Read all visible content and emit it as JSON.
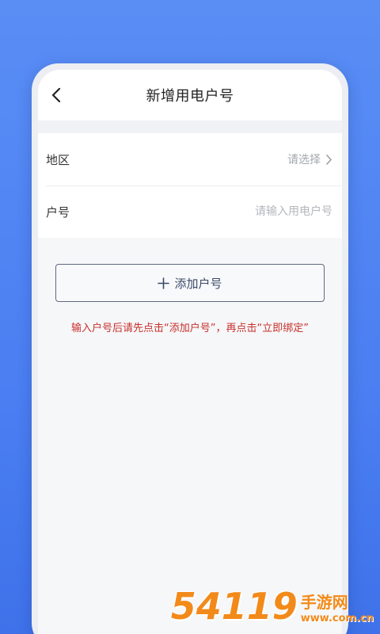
{
  "navbar": {
    "back_icon": "chevron-left-icon",
    "title": "新增用电户号"
  },
  "form": {
    "region": {
      "label": "地区",
      "value": "请选择",
      "icon": "chevron-right-icon"
    },
    "account": {
      "label": "户号",
      "value": "",
      "placeholder": "请输入用电户号"
    }
  },
  "add_button": {
    "icon": "plus-icon",
    "label": "添加户号"
  },
  "hint": "输入户号后请先点击“添加户号”，再点击“立即绑定”",
  "watermark": {
    "number": "54119",
    "text": "手游网",
    "domain": "www.com.cn"
  },
  "colors": {
    "background": "#4b7ff2",
    "hint": "#c8302b",
    "button_border": "#5e6a80",
    "watermark": "#f28a1a"
  }
}
